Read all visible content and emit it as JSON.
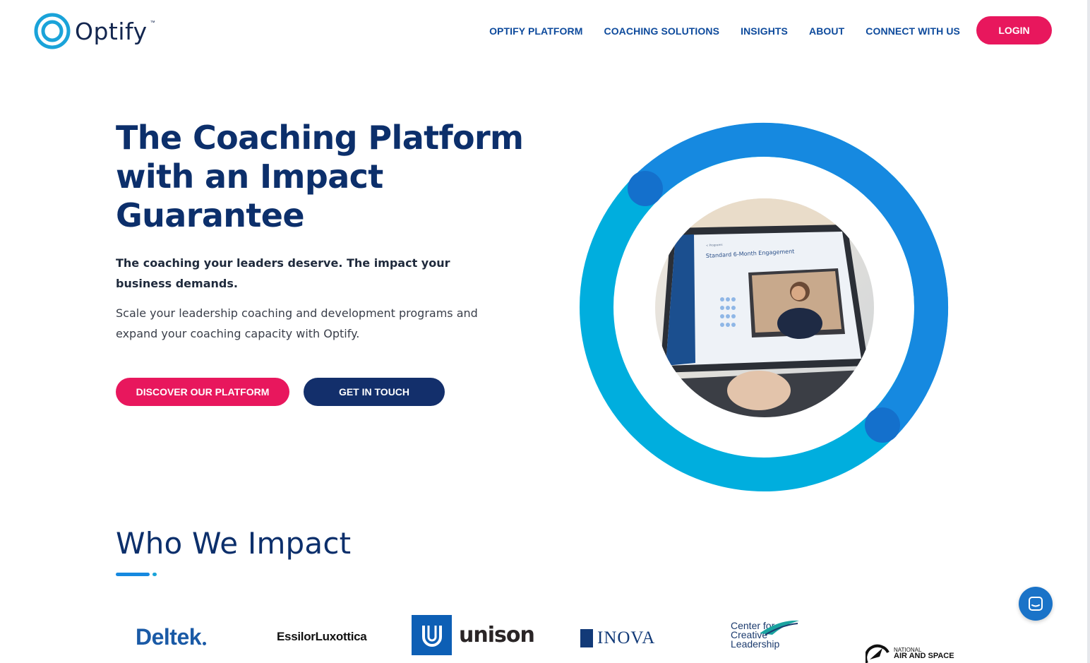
{
  "brand": {
    "name": "Optify",
    "tm": "™"
  },
  "nav": {
    "items": [
      {
        "label": "OPTIFY PLATFORM"
      },
      {
        "label": "COACHING SOLUTIONS"
      },
      {
        "label": "INSIGHTS"
      },
      {
        "label": "ABOUT"
      },
      {
        "label": "CONNECT WITH US"
      }
    ],
    "login_label": "LOGIN"
  },
  "hero": {
    "title": "The Coaching Platform with an Impact Guarantee",
    "subtitle": "The coaching your leaders deserve. The impact your business demands.",
    "body": "Scale your leadership coaching and development programs and expand your coaching capacity with Optify.",
    "cta_primary": "DISCOVER OUR PLATFORM",
    "cta_secondary": "GET IN TOUCH",
    "screen": {
      "title": "Standard 6-Month Engagement",
      "breadcrumb": "< Programs"
    }
  },
  "impact": {
    "title": "Who We Impact",
    "clients": {
      "deltek": "Deltek",
      "essilor": "EssilorLuxottica",
      "unison": "unison",
      "inova": "INOVA",
      "ccl_line1": "Center for",
      "ccl_line2": "Creative",
      "ccl_line3": "Leadership",
      "nasm_line1": "NATIONAL",
      "nasm_line2": "AIR AND SPACE"
    }
  },
  "colors": {
    "accent_pink": "#e8175d",
    "navy": "#0c2f6b",
    "ring_blue": "#1689e0",
    "ring_cyan": "#00aede"
  },
  "icons": {
    "chat": "chat-bubble-icon"
  }
}
